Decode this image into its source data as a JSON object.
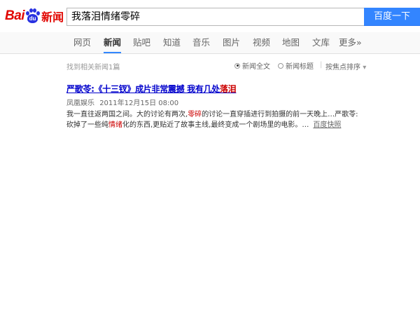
{
  "logo": {
    "text_latin": "Bai",
    "text_paw": "du",
    "text_cn": "新闻"
  },
  "search": {
    "query": "我落泪情绪零碎",
    "button_label": "百度一下"
  },
  "nav": {
    "tabs": [
      "网页",
      "新闻",
      "贴吧",
      "知道",
      "音乐",
      "图片",
      "视频",
      "地图",
      "文库",
      "更多»"
    ],
    "active_index": 1
  },
  "stats": {
    "text": "找到相关新闻1篇"
  },
  "options": {
    "fulltext_label": "新闻全文",
    "title_label": "新闻标题",
    "sort_label": "按焦点排序",
    "sort_arrow": "▾",
    "separator": "|"
  },
  "result": {
    "title_part1": "严歌苓:《十三钗》成片非常震撼 我有几处",
    "title_highlight": "落泪",
    "source": "凤凰娱乐",
    "date": "2011年12月15日 08:00",
    "line1_a": "我一直往返两国之间。大的讨论有两次,",
    "line1_hl": "零碎",
    "line1_b": "的讨论一直穿插进行到拍摄的前一天晚上…严歌苓:",
    "line2_a": "砍掉了一些纯",
    "line2_hl": "情绪",
    "line2_b": "化的东西,更贴近了故事主线,最终变成一个剧场里的电影。…",
    "cache_label": "百度快照"
  },
  "colors": {
    "brand_red": "#e10601",
    "brand_blue": "#2932e1",
    "button_blue": "#3385ff",
    "link_blue": "#0000cc",
    "highlight_red": "#cc0000"
  }
}
